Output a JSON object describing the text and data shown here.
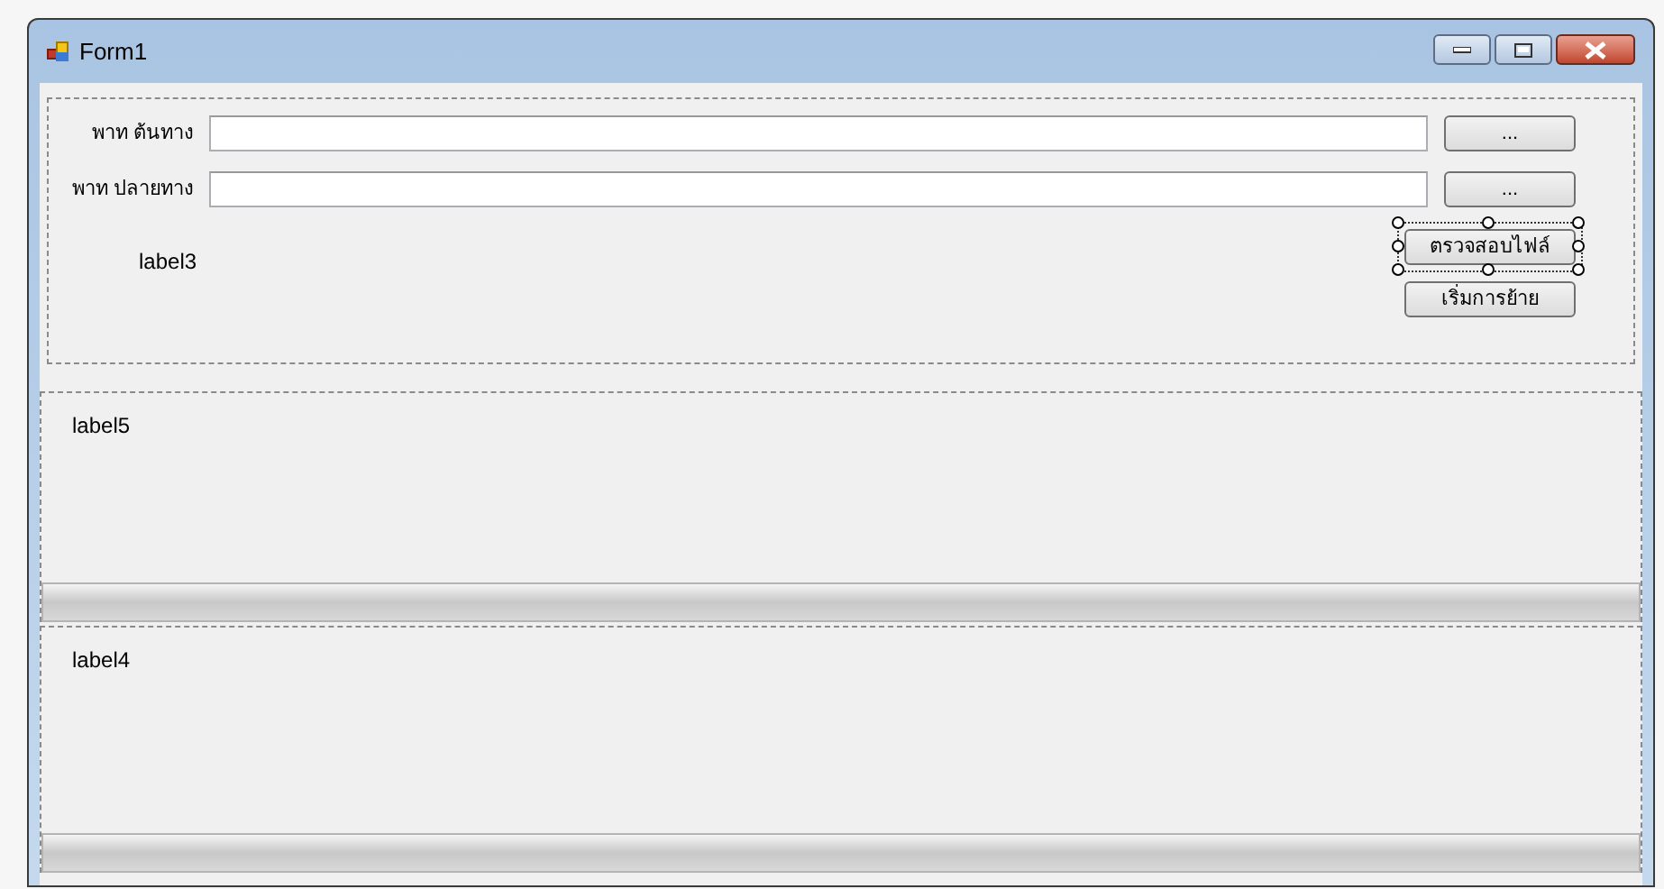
{
  "window": {
    "title": "Form1"
  },
  "paths": [
    {
      "label": "พาท ต้นทาง",
      "button": "..."
    },
    {
      "label": "พาท ปลายทาง",
      "button": "..."
    }
  ],
  "status_label": "label3",
  "actions": [
    {
      "label": "ตรวจสอบไฟล์",
      "selected": true
    },
    {
      "label": "เริ่มการย้าย",
      "selected": false
    }
  ],
  "panels": [
    {
      "label": "label5",
      "progress": {
        "level": 0
      }
    },
    {
      "label": "label4",
      "progress": {
        "level": 0
      }
    }
  ]
}
